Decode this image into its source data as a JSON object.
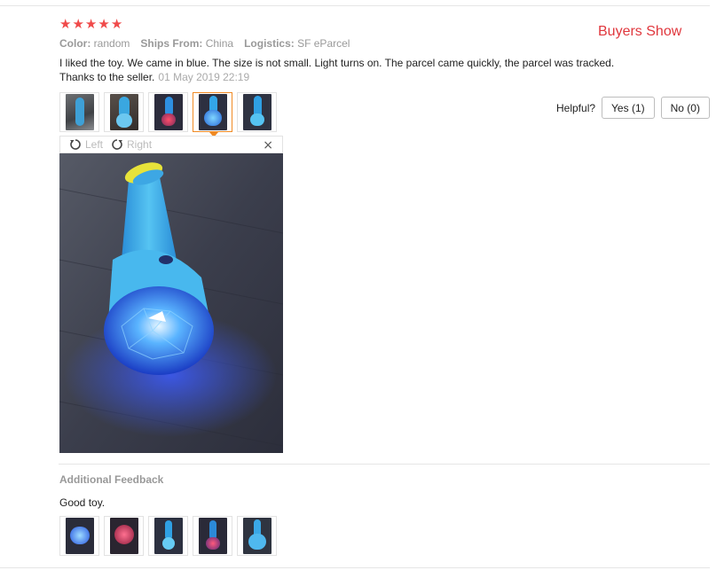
{
  "rating": {
    "stars": 5,
    "star_glyph": "★",
    "color": "#f04a4a"
  },
  "buyers_show_label": "Buyers Show",
  "meta": {
    "color_key": "Color:",
    "color_val": "random",
    "ships_key": "Ships From:",
    "ships_val": "China",
    "logistics_key": "Logistics:",
    "logistics_val": "SF eParcel"
  },
  "review": {
    "text": "I liked the toy. We came in blue. The size is not small. Light turns on. The parcel came quickly, the parcel was tracked. Thanks to the seller.",
    "date": "01 May 2019 22:19"
  },
  "helpful": {
    "label": "Helpful?",
    "yes": "Yes (1)",
    "no": "No (0)"
  },
  "viewer": {
    "left": "Left",
    "right": "Right",
    "close": "×"
  },
  "additional": {
    "title": "Additional Feedback",
    "text": "Good toy."
  },
  "colors": {
    "accent_orange": "#f08a24",
    "brand_red": "#e0373d"
  }
}
